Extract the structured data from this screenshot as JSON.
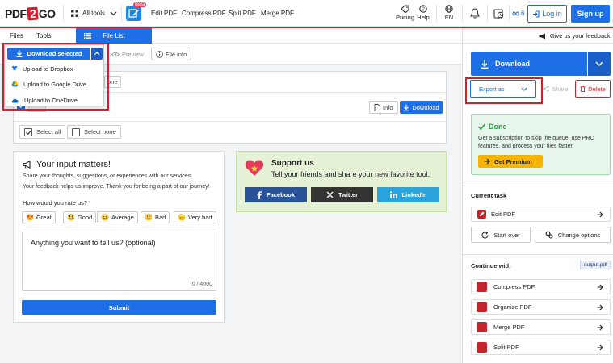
{
  "nav": {
    "logo_pre": "PDF",
    "logo_mid": "2",
    "logo_post": "GO",
    "all_tools": "All tools",
    "beta": "Beta",
    "edit_pdf": "Edit PDF",
    "compress_pdf": "Compress PDF",
    "split_pdf": "Split PDF",
    "merge_pdf": "Merge PDF",
    "pricing": "Pricing",
    "help": "Help",
    "lang": "EN",
    "credits": "6",
    "login": "Log in",
    "signup": "Sign up"
  },
  "tabs": {
    "files": "Files",
    "tools": "Tools",
    "file_list": "File List"
  },
  "toolbar": {
    "preview": "Preview",
    "file_info": "File info"
  },
  "dropdown": {
    "label": "Download selected",
    "items": [
      "Upload to Dropbox",
      "Upload to Google Drive",
      "Upload to OneDrive"
    ]
  },
  "filecard": {
    "partial_label": "one",
    "info": "Info",
    "download": "Download",
    "select_all": "Select all",
    "select_none": "Select none"
  },
  "feedback": {
    "title": "Your input matters!",
    "line1": "Share your thoughts, suggestions, or experiences with our services.",
    "line2": "Your feedback helps us improve. Thank you for being a part of our journey!",
    "rate_q": "How would you rate us?",
    "ratings": [
      "Great",
      "Good",
      "Average",
      "Bad",
      "Very bad"
    ],
    "placeholder": "Anything you want to tell us? (optional)",
    "counter": "0 / 4000",
    "submit": "Submit"
  },
  "support": {
    "title": "Support us",
    "subtitle": "Tell your friends and share your new favorite tool.",
    "facebook": "Facebook",
    "twitter": "Twitter",
    "linkedin": "LinkedIn"
  },
  "right": {
    "feedback_link": "Give us your feedback",
    "download": "Download",
    "export_as": "Export as",
    "share": "Share",
    "delete": "Delete",
    "done_title": "Done",
    "done_text": "Get a subscription to skip the queue, use PRO features, and process your files faster.",
    "premium": "Get Premium",
    "current_task": "Current task",
    "edit_pdf": "Edit PDF",
    "start_over": "Start over",
    "change_options": "Change options",
    "continue_with": "Continue with",
    "output_file": "output.pdf",
    "continue_items": [
      "Compress PDF",
      "Organize PDF",
      "Merge PDF",
      "Split PDF"
    ]
  },
  "colors": {
    "brand_red": "#d01f2d",
    "primary_blue": "#1e6fe6",
    "success_green": "#2e9a43",
    "premium_yellow": "#f4b400"
  }
}
